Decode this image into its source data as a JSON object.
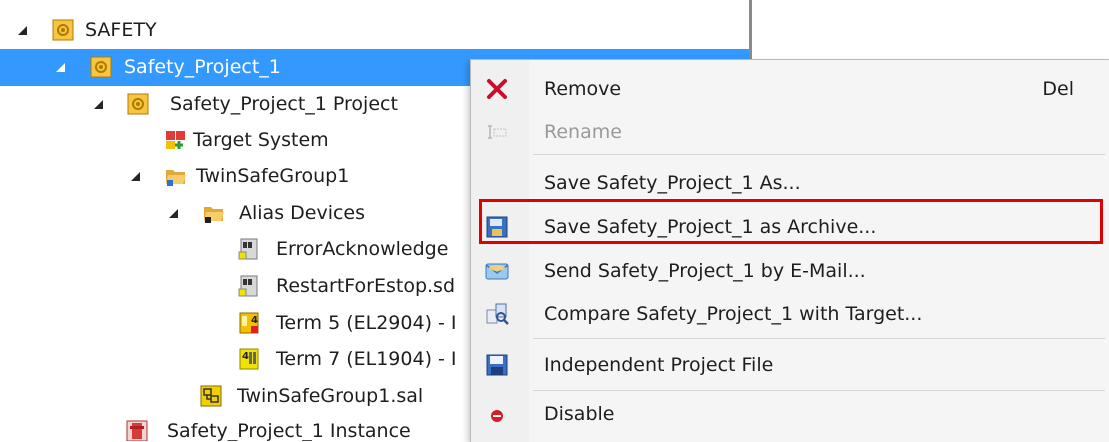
{
  "tree": {
    "items": [
      {
        "label": "SAFETY",
        "expander": "expanded-arrow",
        "icon": "safety-icon"
      },
      {
        "label": "Safety_Project_1",
        "expander": "expanded-arrow",
        "icon": "safety-project-icon",
        "selected": true
      },
      {
        "label": "Safety_Project_1 Project",
        "expander": "expanded-arrow",
        "icon": "safety-project-icon"
      },
      {
        "label": "Target System",
        "icon": "target-system-icon"
      },
      {
        "label": "TwinSafeGroup1",
        "expander": "expanded-arrow",
        "icon": "folder-icon"
      },
      {
        "label": "Alias Devices",
        "expander": "expanded-arrow",
        "icon": "folder-icon"
      },
      {
        "label": "ErrorAcknowledge",
        "icon": "alias-device-icon"
      },
      {
        "label": "RestartForEstop.sd",
        "icon": "alias-device-icon"
      },
      {
        "label": "Term 5 (EL2904) - I",
        "icon": "output-terminal-icon"
      },
      {
        "label": "Term 7 (EL1904) - I",
        "icon": "input-terminal-icon"
      },
      {
        "label": "TwinSafeGroup1.sal",
        "icon": "sal-file-icon"
      },
      {
        "label": "Safety_Project_1 Instance",
        "icon": "instance-icon"
      }
    ]
  },
  "context_menu": {
    "items": [
      {
        "label": "Remove",
        "shortcut": "Del",
        "icon": "remove-icon"
      },
      {
        "label": "Rename",
        "icon": "rename-icon",
        "disabled": true
      },
      {
        "label": "Save Safety_Project_1 As..."
      },
      {
        "label": "Save Safety_Project_1 as Archive...",
        "icon": "archive-icon",
        "highlighted": true
      },
      {
        "label": "Send Safety_Project_1 by E-Mail...",
        "icon": "email-icon"
      },
      {
        "label": "Compare Safety_Project_1 with Target...",
        "icon": "compare-icon"
      },
      {
        "label": "Independent Project File",
        "icon": "save-icon"
      },
      {
        "label": "Disable",
        "icon": "disable-icon"
      }
    ]
  },
  "colors": {
    "selection": "#3399ff",
    "highlight_box": "#e00000",
    "menu_background": "#f5f5f5"
  }
}
